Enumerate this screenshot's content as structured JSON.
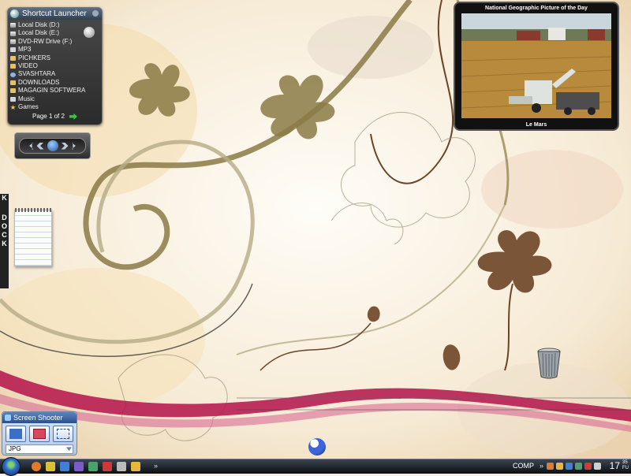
{
  "launcher": {
    "title": "Shortcut Launcher",
    "items": [
      {
        "label": "Local Disk (D:)",
        "icon": "disk-icon"
      },
      {
        "label": "Local Disk (E:)",
        "icon": "disk-icon"
      },
      {
        "label": "DVD-RW Drive (F:)",
        "icon": "dvd-drive-icon"
      },
      {
        "label": "MP3",
        "icon": "music-icon"
      },
      {
        "label": "PICHKERS",
        "icon": "folder-icon"
      },
      {
        "label": "VIDEO",
        "icon": "folder-icon"
      },
      {
        "label": "SVASHTARA",
        "icon": "globe-icon"
      },
      {
        "label": "DOWNLOADS",
        "icon": "folder-icon"
      },
      {
        "label": "MAGAGIN SOFTWERA",
        "icon": "folder-icon"
      },
      {
        "label": "Music",
        "icon": "music-icon"
      },
      {
        "label": "Games",
        "icon": "star-icon"
      }
    ],
    "pagination": "Page 1 of 2"
  },
  "kdock": {
    "letters": [
      "K",
      "D",
      "O",
      "C",
      "K"
    ]
  },
  "natgeo": {
    "title": "National Geographic Picture of the Day",
    "caption": "Le Mars"
  },
  "screen_shooter": {
    "title": "Screen Shooter",
    "format": "JPG"
  },
  "taskbar": {
    "toolbar_label": "COMP",
    "clock": "17",
    "clock_small_top": "35",
    "clock_small_bottom": "FU",
    "chevron": "»"
  },
  "colors": {
    "ribbon": "#b3124a",
    "ornament_gold": "#8a7a45",
    "ornament_brown": "#6b4425"
  }
}
